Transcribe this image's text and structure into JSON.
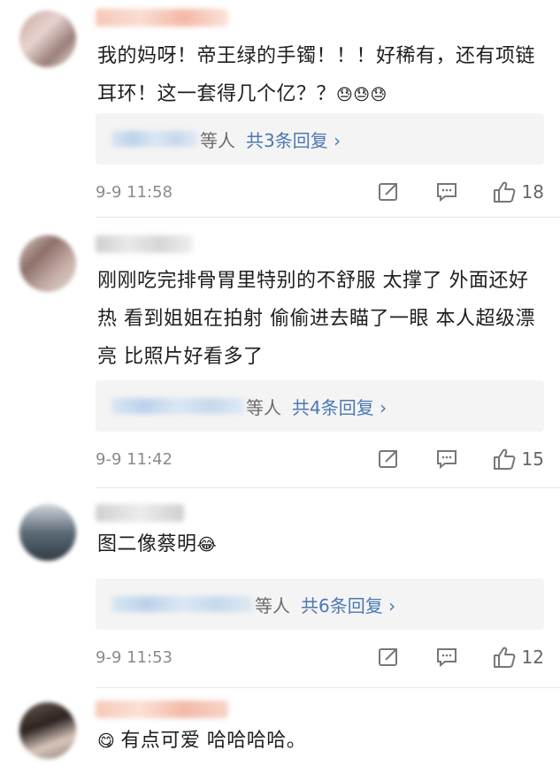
{
  "comments": [
    {
      "text": "我的妈呀！帝王绿的手镯！！！好稀有，还有项链耳环！这一套得几个亿？？",
      "emoji": "😓😓😓",
      "reply_who": "等人",
      "reply_count": "共3条回复 ›",
      "time": "9-9 11:58",
      "likes": "18"
    },
    {
      "text": "刚刚吃完排骨胃里特别的不舒服 太撑了 外面还好热 看到姐姐在拍射 偷偷进去瞄了一眼 本人超级漂亮 比照片好看多了",
      "emoji": "",
      "reply_who": "等人",
      "reply_count": "共4条回复 ›",
      "time": "9-9 11:42",
      "likes": "15"
    },
    {
      "text": "图二像蔡明",
      "emoji": "😂",
      "reply_who": "等人",
      "reply_count": "共6条回复 ›",
      "time": "9-9 11:53",
      "likes": "12"
    },
    {
      "text": "有点可爱 哈哈哈哈。",
      "emoji": "😋"
    }
  ]
}
